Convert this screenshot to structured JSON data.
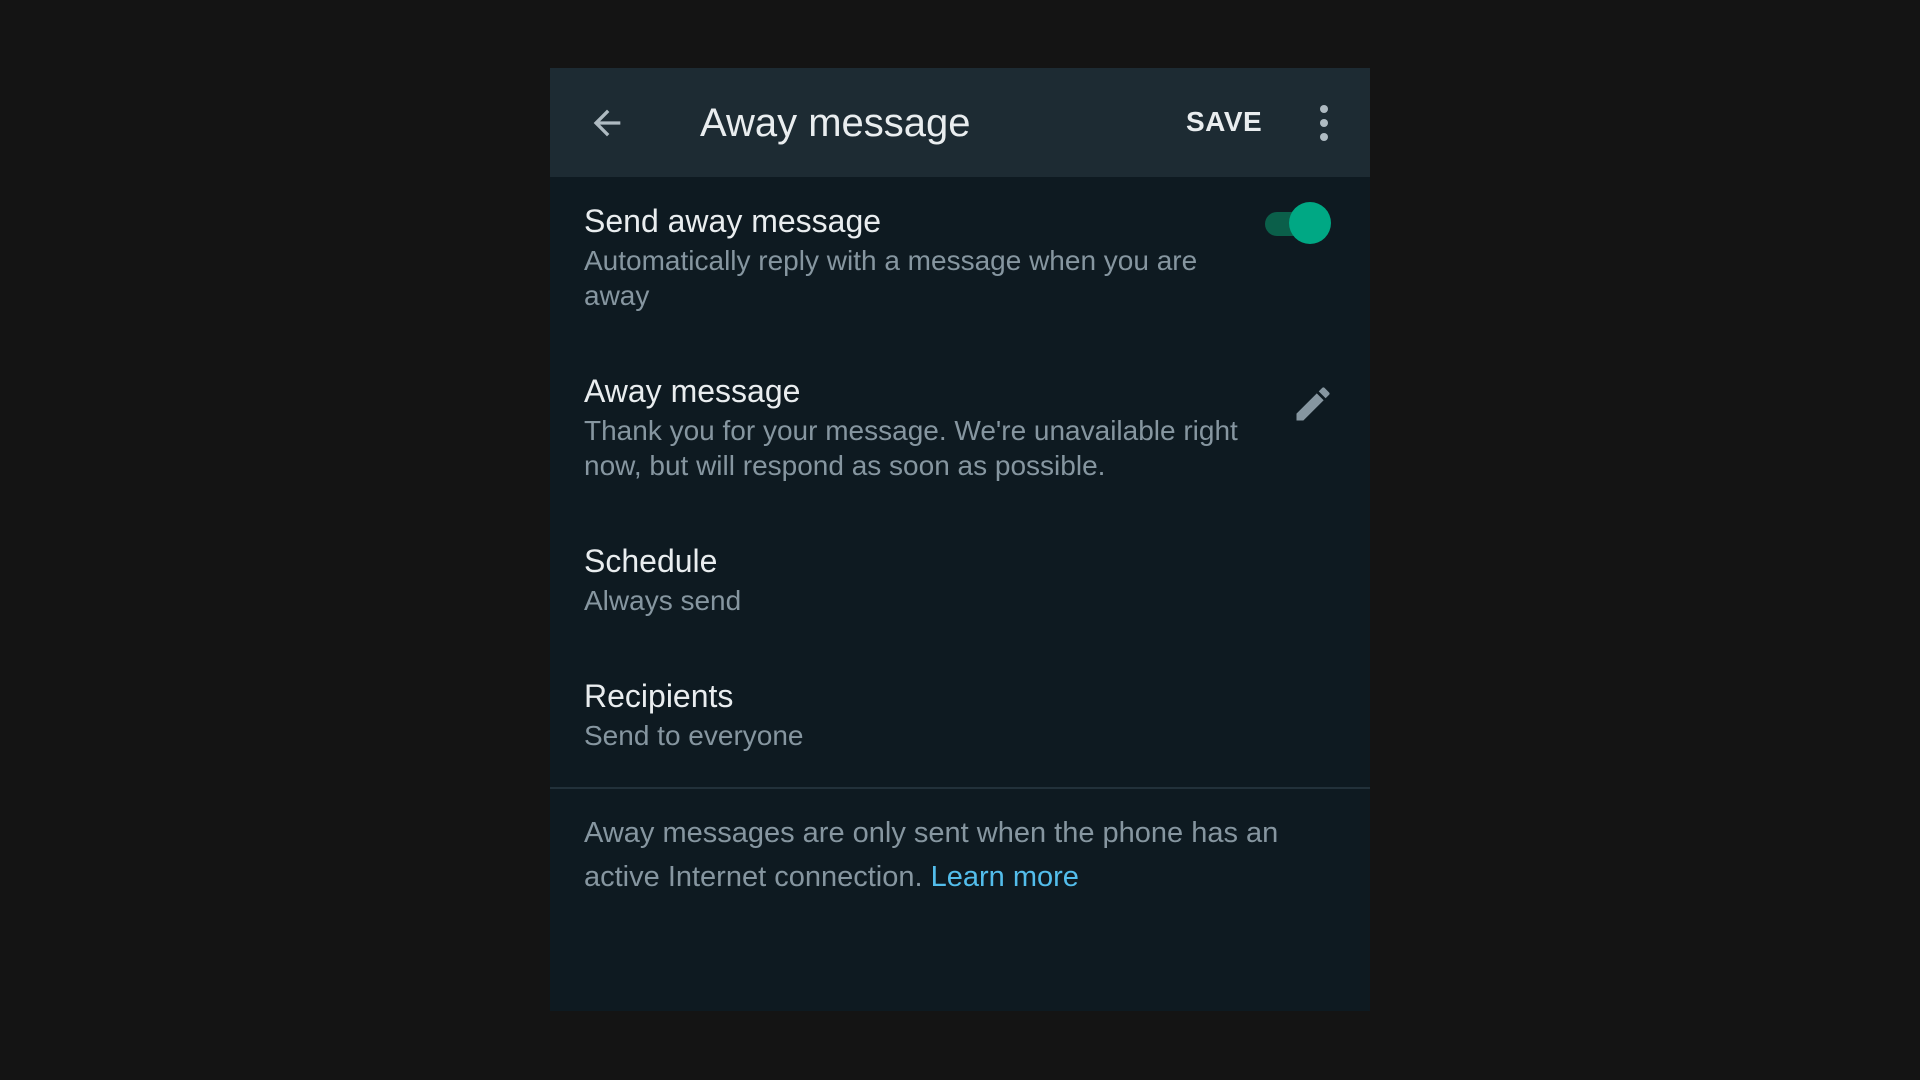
{
  "appbar": {
    "title": "Away message",
    "save_label": "SAVE",
    "back_icon": "arrow-left-icon",
    "more_icon": "more-vertical-icon"
  },
  "settings": {
    "send_away": {
      "title": "Send away message",
      "subtitle": "Automatically reply with a message when you are away",
      "enabled": true
    },
    "away_message": {
      "title": "Away message",
      "subtitle": "Thank you for your message. We're unavailable right now, but will respond as soon as possible.",
      "edit_icon": "pencil-icon"
    },
    "schedule": {
      "title": "Schedule",
      "subtitle": "Always send"
    },
    "recipients": {
      "title": "Recipients",
      "subtitle": "Send to everyone"
    }
  },
  "footer": {
    "text": "Away messages are only sent when the phone has an active Internet connection.",
    "link_label": "Learn more"
  },
  "colors": {
    "background": "#141414",
    "screen": "#0e1a21",
    "appbar": "#1d2b33",
    "accent": "#00a884",
    "link": "#53bdeb",
    "primary_text": "#e9edef",
    "secondary_text": "#8696a0"
  }
}
